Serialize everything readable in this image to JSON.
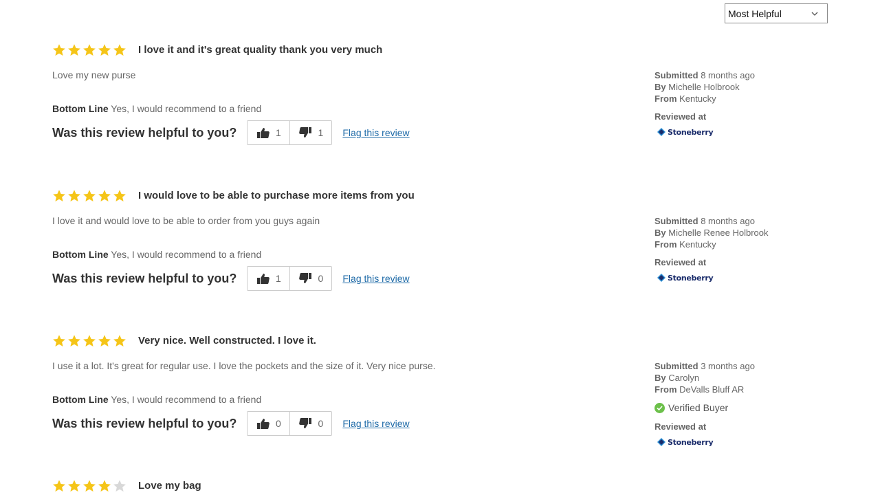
{
  "sort": {
    "selected": "Most Helpful"
  },
  "colors": {
    "star_filled": "#f5c518",
    "star_empty": "#d8d8d8",
    "link": "#1f6ba8",
    "verified": "#6cc04a"
  },
  "labels": {
    "bottom_line": "Bottom Line",
    "helpful_question": "Was this review helpful to you?",
    "flag": "Flag this review",
    "submitted": "Submitted",
    "by": "By",
    "from": "From",
    "reviewed_at": "Reviewed at",
    "verified_buyer": "Verified Buyer",
    "retailer_name": "Stoneberry"
  },
  "reviews": [
    {
      "rating": 5,
      "headline": "I love it and it's great quality thank you very much",
      "body": "Love my new purse",
      "bottom_line": "Yes, I would recommend to a friend",
      "helpful_yes": "1",
      "helpful_no": "1",
      "submitted": "8 months ago",
      "author": "Michelle Holbrook",
      "location": "Kentucky",
      "verified": false
    },
    {
      "rating": 5,
      "headline": "I would love to be able to purchase more items from you",
      "body": "I love it and would love to be able to order from you guys again",
      "bottom_line": "Yes, I would recommend to a friend",
      "helpful_yes": "1",
      "helpful_no": "0",
      "submitted": "8 months ago",
      "author": "Michelle Renee Holbrook",
      "location": "Kentucky",
      "verified": false
    },
    {
      "rating": 5,
      "headline": "Very nice. Well constructed. I love it.",
      "body": "I use it a lot. It's great for regular use. I love the pockets and the size of it. Very nice purse.",
      "bottom_line": "Yes, I would recommend to a friend",
      "helpful_yes": "0",
      "helpful_no": "0",
      "submitted": "3 months ago",
      "author": "Carolyn",
      "location": "DeValls Bluff AR",
      "verified": true
    },
    {
      "rating": 4,
      "headline": "Love my bag"
    }
  ]
}
